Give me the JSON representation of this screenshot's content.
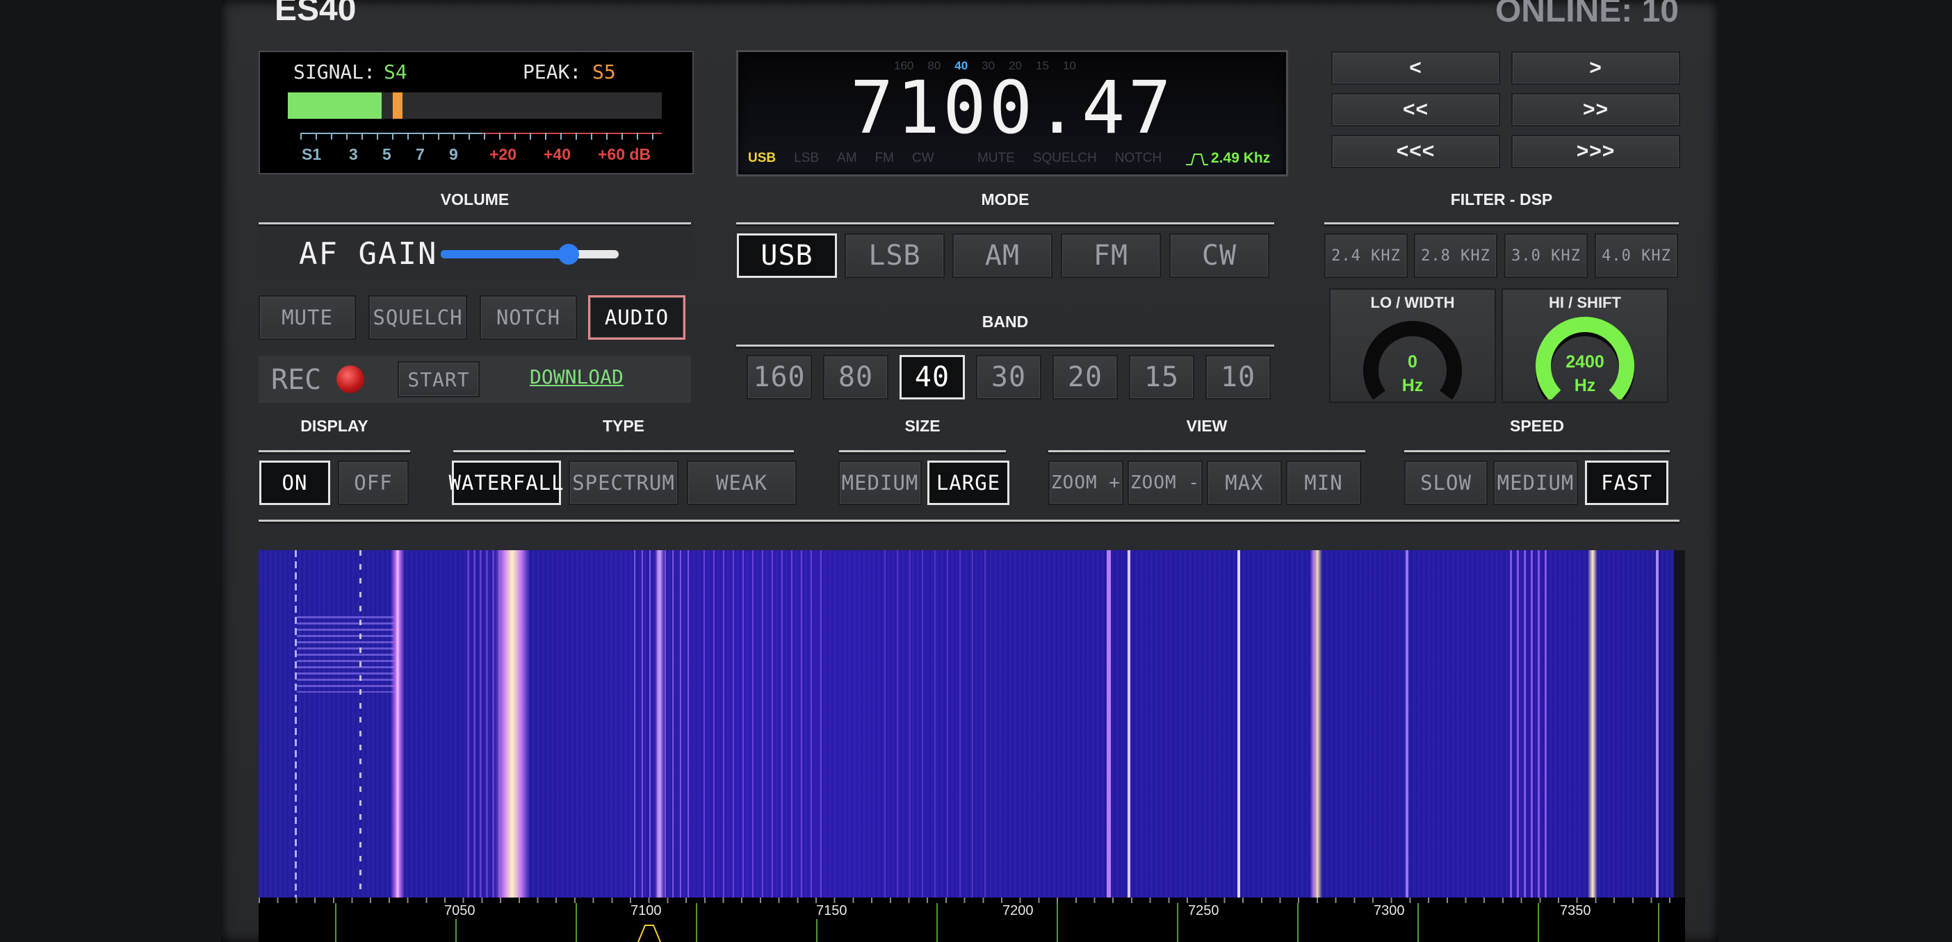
{
  "station": "ES40",
  "online": "ONLINE: 10",
  "meter": {
    "signal_label": "SIGNAL:",
    "signal_value": "S4",
    "peak_label": "PEAK:",
    "peak_value": "S5",
    "signal_level": 0.25,
    "peak_level": 0.28,
    "scale": [
      "S1",
      "3",
      "5",
      "7",
      "9",
      "+20",
      "+40",
      "+60 dB"
    ]
  },
  "freq": {
    "display": "7100.47",
    "bands_mini": [
      "160",
      "80",
      "40",
      "30",
      "20",
      "15",
      "10"
    ],
    "modes_mini": [
      "USB",
      "LSB",
      "AM",
      "FM",
      "CW"
    ],
    "flags_mini": [
      "MUTE",
      "SQUELCH",
      "NOTCH"
    ],
    "filter_bw": "2.49 Khz"
  },
  "nav": [
    "<",
    ">",
    "<<",
    ">>",
    "<<<",
    ">>>"
  ],
  "volume": {
    "header": "VOLUME",
    "af_label": "AF GAIN",
    "af_level": 0.72,
    "buttons": [
      "MUTE",
      "SQUELCH",
      "NOTCH",
      "AUDIO"
    ],
    "rec_label": "REC",
    "start_label": "START",
    "download_label": "DOWNLOAD"
  },
  "mode": {
    "header": "MODE",
    "buttons": [
      "USB",
      "LSB",
      "AM",
      "FM",
      "CW"
    ]
  },
  "band": {
    "header": "BAND",
    "buttons": [
      "160",
      "80",
      "40",
      "30",
      "20",
      "15",
      "10"
    ]
  },
  "filter": {
    "header": "FILTER - DSP",
    "buttons": [
      "2.4 KHZ",
      "2.8 KHZ",
      "3.0 KHZ",
      "4.0 KHZ"
    ],
    "lo_title": "LO / WIDTH",
    "lo_value": "0",
    "lo_unit": "Hz",
    "lo_level": 0,
    "hi_title": "HI / SHIFT",
    "hi_value": "2400",
    "hi_unit": "Hz",
    "hi_level": 1
  },
  "display": {
    "header": "DISPLAY",
    "buttons": [
      "ON",
      "OFF"
    ]
  },
  "type": {
    "header": "TYPE",
    "buttons": [
      "WATERFALL",
      "SPECTRUM",
      "WEAK"
    ]
  },
  "size": {
    "header": "SIZE",
    "buttons": [
      "MEDIUM",
      "LARGE"
    ]
  },
  "view": {
    "header": "VIEW",
    "buttons": [
      "ZOOM +",
      "ZOOM -",
      "MAX",
      "MIN"
    ]
  },
  "speed": {
    "header": "SPEED",
    "buttons": [
      "SLOW",
      "MEDIUM",
      "FAST"
    ]
  },
  "scale_labels": [
    "7050",
    "7100",
    "7150",
    "7200",
    "7250",
    "7300",
    "7350"
  ],
  "colors": {
    "accent_green": "#7cf04a",
    "signal_green": "#7fe36a",
    "peak_orange": "#f39a3c",
    "usb_yellow": "#f4d23a",
    "band_blue": "#4fb0ff"
  }
}
